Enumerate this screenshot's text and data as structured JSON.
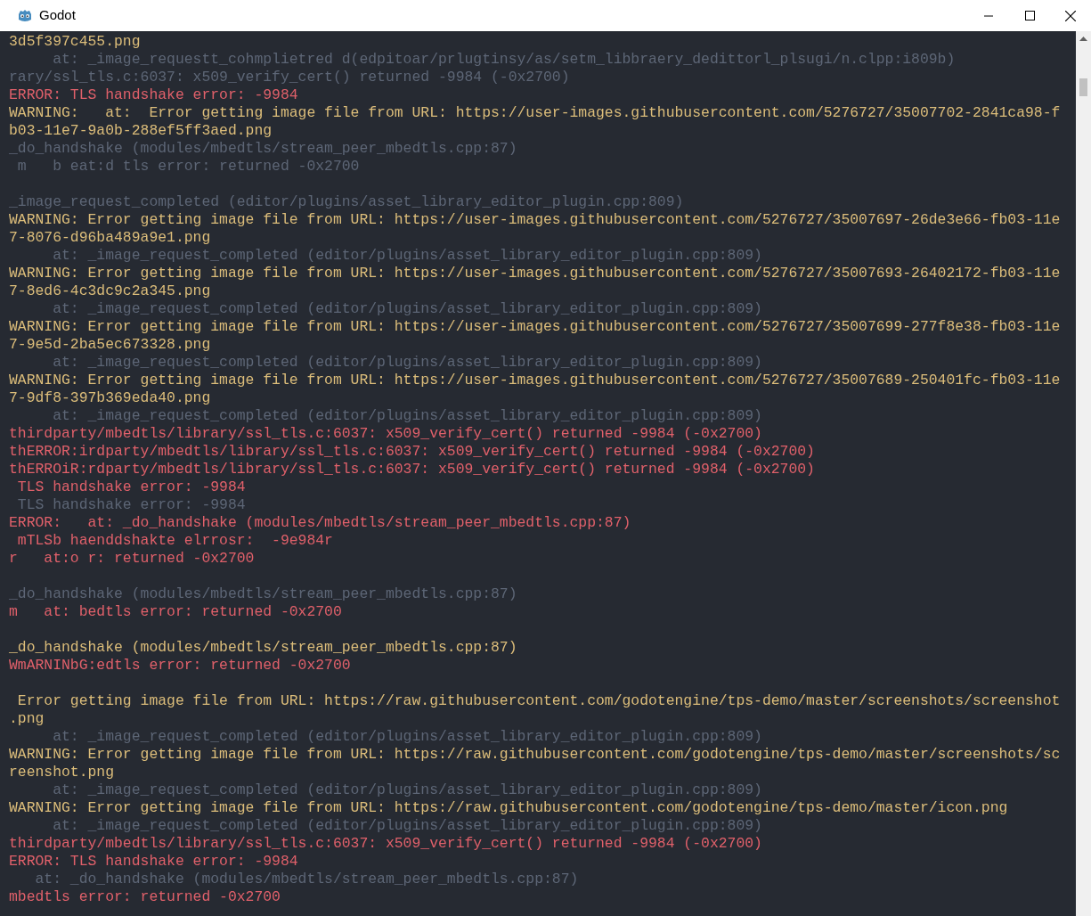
{
  "window": {
    "title": "Godot"
  },
  "lines": [
    {
      "kind": "warning",
      "text": "3d5f397c455.png"
    },
    {
      "kind": "trace",
      "text": "     at: _image_requestt_cohmplietred d(edpitoar/prlugtinsy/as/setm_libbraery_dedittorl_plsugi/n.clpp:i809b)"
    },
    {
      "kind": "trace",
      "text": "rary/ssl_tls.c:6037: x509_verify_cert() returned -9984 (-0x2700)"
    },
    {
      "kind": "error",
      "text": "ERROR: TLS handshake error: -9984"
    },
    {
      "kind": "warning",
      "text": "WARNING:   at:  Error getting image file from URL: https://user-images.githubusercontent.com/5276727/35007702-2841ca98-f"
    },
    {
      "kind": "warning",
      "text": "b03-11e7-9a0b-288ef5ff3aed.png"
    },
    {
      "kind": "trace",
      "text": "_do_handshake (modules/mbedtls/stream_peer_mbedtls.cpp:87)"
    },
    {
      "kind": "trace",
      "text": " m   b eat:d tls error: returned -0x2700"
    },
    {
      "kind": "blank"
    },
    {
      "kind": "trace",
      "text": "_image_request_completed (editor/plugins/asset_library_editor_plugin.cpp:809)"
    },
    {
      "kind": "warning",
      "text": "WARNING: Error getting image file from URL: https://user-images.githubusercontent.com/5276727/35007697-26de3e66-fb03-11e"
    },
    {
      "kind": "warning",
      "text": "7-8076-d96ba489a9e1.png"
    },
    {
      "kind": "trace",
      "text": "     at: _image_request_completed (editor/plugins/asset_library_editor_plugin.cpp:809)"
    },
    {
      "kind": "warning",
      "text": "WARNING: Error getting image file from URL: https://user-images.githubusercontent.com/5276727/35007693-26402172-fb03-11e"
    },
    {
      "kind": "warning",
      "text": "7-8ed6-4c3dc9c2a345.png"
    },
    {
      "kind": "trace",
      "text": "     at: _image_request_completed (editor/plugins/asset_library_editor_plugin.cpp:809)"
    },
    {
      "kind": "warning",
      "text": "WARNING: Error getting image file from URL: https://user-images.githubusercontent.com/5276727/35007699-277f8e38-fb03-11e"
    },
    {
      "kind": "warning",
      "text": "7-9e5d-2ba5ec673328.png"
    },
    {
      "kind": "trace",
      "text": "     at: _image_request_completed (editor/plugins/asset_library_editor_plugin.cpp:809)"
    },
    {
      "kind": "warning",
      "text": "WARNING: Error getting image file from URL: https://user-images.githubusercontent.com/5276727/35007689-250401fc-fb03-11e"
    },
    {
      "kind": "warning",
      "text": "7-9df8-397b369eda40.png"
    },
    {
      "kind": "trace",
      "text": "     at: _image_request_completed (editor/plugins/asset_library_editor_plugin.cpp:809)"
    },
    {
      "kind": "error",
      "text": "thirdparty/mbedtls/library/ssl_tls.c:6037: x509_verify_cert() returned -9984 (-0x2700)"
    },
    {
      "kind": "error",
      "text": "thERROR:irdparty/mbedtls/library/ssl_tls.c:6037: x509_verify_cert() returned -9984 (-0x2700)"
    },
    {
      "kind": "error",
      "text": "thERROiR:rdparty/mbedtls/library/ssl_tls.c:6037: x509_verify_cert() returned -9984 (-0x2700)"
    },
    {
      "kind": "error",
      "text": " TLS handshake error: -9984"
    },
    {
      "kind": "trace",
      "text": " TLS handshake error: -9984"
    },
    {
      "kind": "error",
      "text": "ERROR:   at: _do_handshake (modules/mbedtls/stream_peer_mbedtls.cpp:87)"
    },
    {
      "kind": "error",
      "text": " mTLSb haenddshakte elrrosr:  -9e984r"
    },
    {
      "kind": "error",
      "text": "r   at:o r: returned -0x2700"
    },
    {
      "kind": "blank"
    },
    {
      "kind": "trace",
      "text": "_do_handshake (modules/mbedtls/stream_peer_mbedtls.cpp:87)"
    },
    {
      "kind": "error",
      "text": "m   at: bedtls error: returned -0x2700"
    },
    {
      "kind": "blank"
    },
    {
      "kind": "warning",
      "text": "_do_handshake (modules/mbedtls/stream_peer_mbedtls.cpp:87)"
    },
    {
      "kind": "error",
      "text": "WmARNINbG:edtls error: returned -0x2700"
    },
    {
      "kind": "blank"
    },
    {
      "kind": "warning",
      "text": " Error getting image file from URL: https://raw.githubusercontent.com/godotengine/tps-demo/master/screenshots/screenshot"
    },
    {
      "kind": "warning",
      "text": ".png"
    },
    {
      "kind": "trace",
      "text": "     at: _image_request_completed (editor/plugins/asset_library_editor_plugin.cpp:809)"
    },
    {
      "kind": "warning",
      "text": "WARNING: Error getting image file from URL: https://raw.githubusercontent.com/godotengine/tps-demo/master/screenshots/sc"
    },
    {
      "kind": "warning",
      "text": "reenshot.png"
    },
    {
      "kind": "trace",
      "text": "     at: _image_request_completed (editor/plugins/asset_library_editor_plugin.cpp:809)"
    },
    {
      "kind": "warning",
      "text": "WARNING: Error getting image file from URL: https://raw.githubusercontent.com/godotengine/tps-demo/master/icon.png"
    },
    {
      "kind": "trace",
      "text": "     at: _image_request_completed (editor/plugins/asset_library_editor_plugin.cpp:809)"
    },
    {
      "kind": "error",
      "text": "thirdparty/mbedtls/library/ssl_tls.c:6037: x509_verify_cert() returned -9984 (-0x2700)"
    },
    {
      "kind": "error",
      "text": "ERROR: TLS handshake error: -9984"
    },
    {
      "kind": "trace",
      "text": "   at: _do_handshake (modules/mbedtls/stream_peer_mbedtls.cpp:87)"
    },
    {
      "kind": "error",
      "text": "mbedtls error: returned -0x2700"
    }
  ]
}
